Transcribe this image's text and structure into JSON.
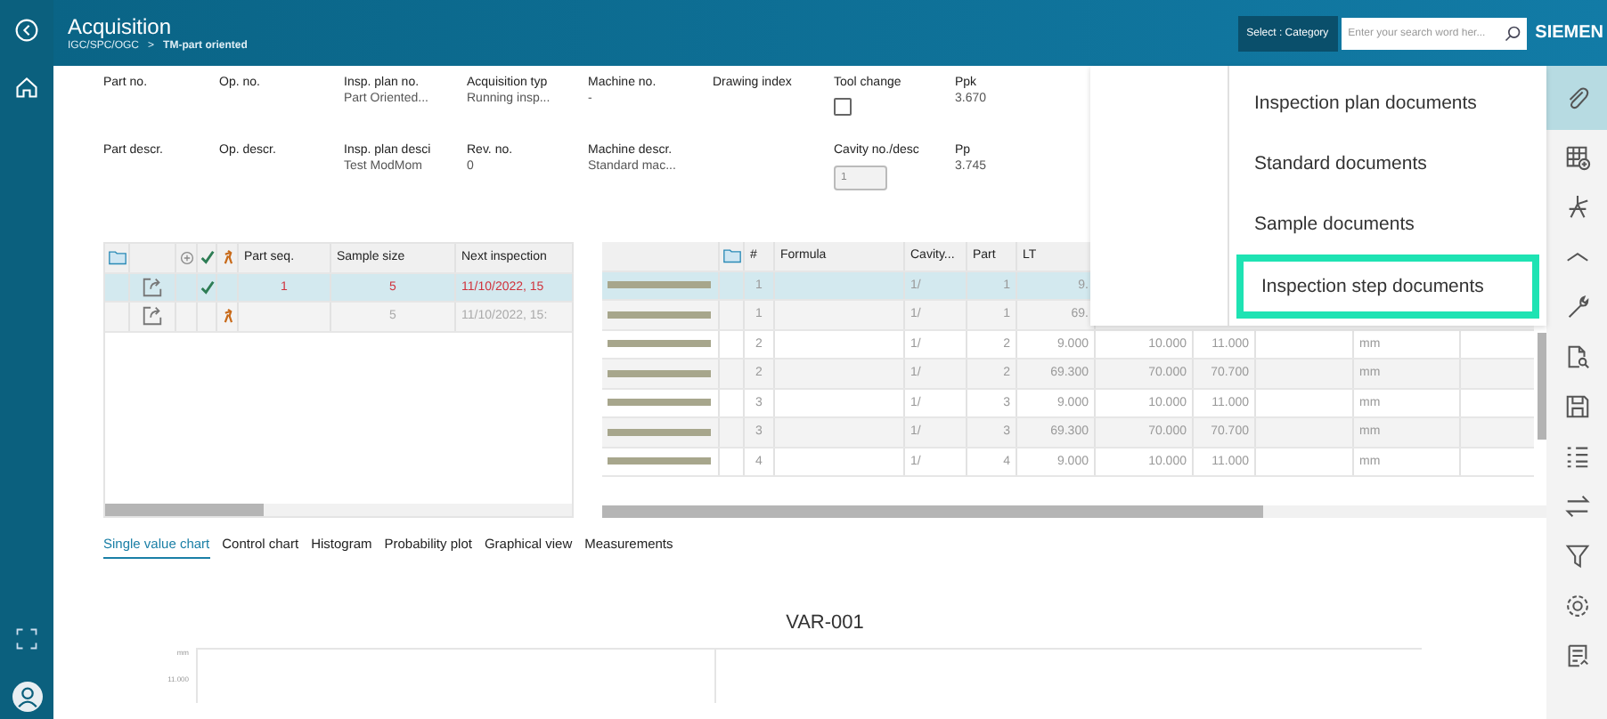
{
  "header": {
    "title": "Acquisition",
    "breadcrumb": [
      "IGC/SPC/OGC",
      "TM-part oriented"
    ],
    "breadcrumb_separator": ">",
    "category_button": "Select : Category",
    "search": {
      "placeholder": "Enter your search word her..."
    },
    "brand": "SIEMEN"
  },
  "fields": [
    {
      "kind": "text",
      "label": "Part no."
    },
    {
      "kind": "text",
      "label": "Op. no."
    },
    {
      "kind": "text",
      "label": "Insp. plan no.",
      "value": "Part Oriented..."
    },
    {
      "kind": "text",
      "label": "Acquisition typ",
      "value": "Running insp..."
    },
    {
      "kind": "text",
      "label": "Machine no.",
      "value": "-"
    },
    {
      "kind": "text",
      "label": "Drawing index"
    },
    {
      "kind": "checkbox",
      "label": "Tool change",
      "checked": false
    },
    {
      "kind": "text",
      "label": "Ppk",
      "value": "3.670"
    },
    {
      "kind": "text",
      "label": "Part descr."
    },
    {
      "kind": "text",
      "label": "Op. descr."
    },
    {
      "kind": "text",
      "label": "Insp. plan desci",
      "value": "Test ModMom"
    },
    {
      "kind": "text",
      "label": "Rev. no.",
      "value": "0"
    },
    {
      "kind": "text",
      "label": "Machine descr.",
      "value": "Standard mac..."
    },
    {
      "kind": "spacer"
    },
    {
      "kind": "input",
      "label": "Cavity no./desc",
      "value": "1",
      "disabled": true
    },
    {
      "kind": "text",
      "label": "Pp",
      "value": "3.745"
    }
  ],
  "sample_table": {
    "columns": [
      "Part seq.",
      "Sample size",
      "Next inspection"
    ],
    "rows": [
      {
        "selected": true,
        "checked": true,
        "manual": false,
        "overdue": true,
        "part_seq": "1",
        "sample_size": "5",
        "next_inspection": "11/10/2022, 15"
      },
      {
        "selected": false,
        "checked": false,
        "manual": true,
        "overdue": false,
        "sample_size": "5",
        "next_inspection": "11/10/2022, 15:"
      }
    ]
  },
  "characteristics_table": {
    "columns": [
      "#",
      "Formula",
      "Cavity...",
      "Part",
      "LT"
    ],
    "rows": [
      {
        "selected": true,
        "cells": [
          "1",
          "",
          "1/",
          "1",
          "9."
        ]
      },
      {
        "selected": false,
        "cells": [
          "1",
          "",
          "1/",
          "1",
          "69."
        ]
      },
      {
        "selected": false,
        "cells": [
          "2",
          "",
          "1/",
          "2",
          "9.000",
          "10.000",
          "11.000",
          "",
          "mm",
          ""
        ]
      },
      {
        "selected": false,
        "cells": [
          "2",
          "",
          "1/",
          "2",
          "69.300",
          "70.000",
          "70.700",
          "",
          "mm",
          ""
        ]
      },
      {
        "selected": false,
        "cells": [
          "3",
          "",
          "1/",
          "3",
          "9.000",
          "10.000",
          "11.000",
          "",
          "mm",
          ""
        ]
      },
      {
        "selected": false,
        "cells": [
          "3",
          "",
          "1/",
          "3",
          "69.300",
          "70.000",
          "70.700",
          "",
          "mm",
          ""
        ]
      },
      {
        "selected": false,
        "cells": [
          "4",
          "",
          "1/",
          "4",
          "9.000",
          "10.000",
          "11.000",
          "",
          "mm",
          ""
        ]
      }
    ]
  },
  "documents_menu": [
    {
      "label": "Inspection plan documents",
      "selected": false
    },
    {
      "label": "Standard documents",
      "selected": false
    },
    {
      "label": "Sample documents",
      "selected": false
    },
    {
      "label": "Inspection step documents",
      "selected": true
    }
  ],
  "chart_tabs": [
    {
      "label": "Single value chart",
      "selected": true
    },
    {
      "label": "Control chart",
      "selected": false
    },
    {
      "label": "Histogram",
      "selected": false
    },
    {
      "label": "Probability plot",
      "selected": false
    },
    {
      "label": "Graphical view",
      "selected": false
    },
    {
      "label": "Measurements",
      "selected": false
    }
  ],
  "chart": {
    "title": "VAR-001",
    "axis_labels": [
      "mm",
      "11.000"
    ]
  },
  "tools": [
    {
      "kind": "paperclip",
      "selected": true
    },
    {
      "kind": "table-add",
      "selected": false
    },
    {
      "kind": "compass",
      "selected": false
    },
    {
      "kind": "shape",
      "selected": false
    },
    {
      "kind": "wrench",
      "selected": false
    },
    {
      "kind": "doc-search",
      "selected": false
    },
    {
      "kind": "save",
      "selected": false
    },
    {
      "kind": "list",
      "selected": false
    },
    {
      "kind": "swap",
      "selected": false
    },
    {
      "kind": "filter",
      "selected": false
    },
    {
      "kind": "settings",
      "selected": false
    },
    {
      "kind": "report",
      "selected": false
    }
  ]
}
